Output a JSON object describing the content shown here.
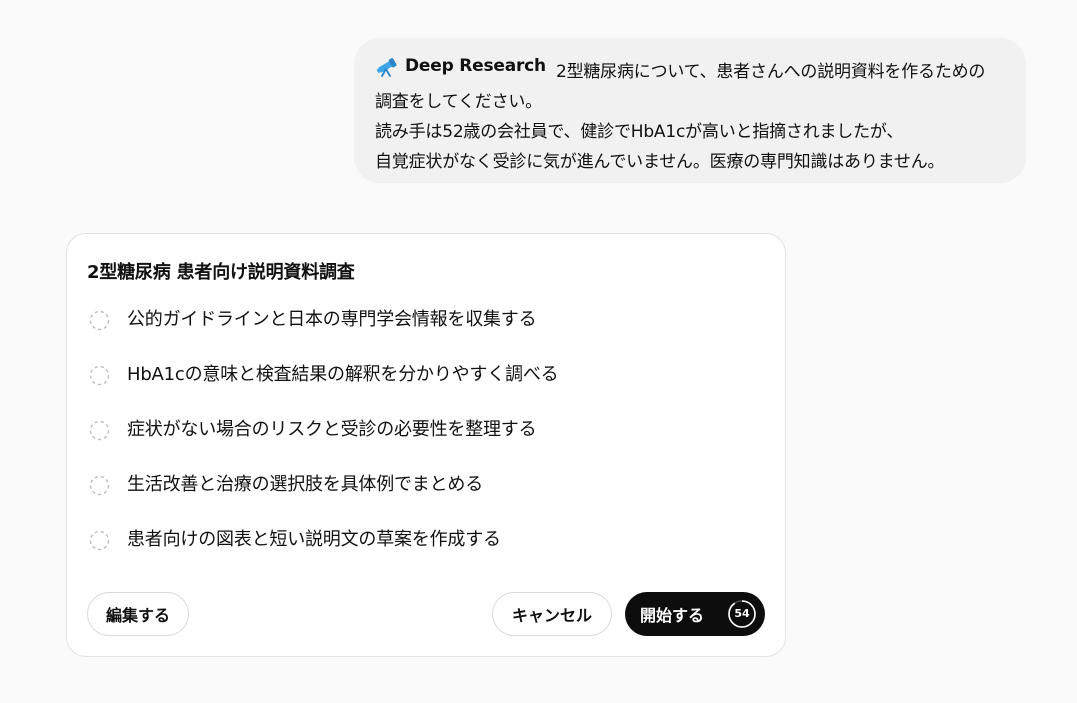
{
  "user_message": {
    "tag_label": "Deep Research",
    "tag_icon": "telescope-icon",
    "lines": [
      "2型糖尿病について、患者さんへの説明資料を作るための",
      "調査をしてください。",
      "読み手は52歳の会社員で、健診でHbA1cが高いと指摘されましたが、",
      "自覚症状がなく受診に気が進んでいません。医療の専門知識はありません。"
    ]
  },
  "plan": {
    "title": "2型糖尿病 患者向け説明資料調査",
    "steps": [
      {
        "label": "公的ガイドラインと日本の専門学会情報を収集する",
        "icon": "pending-circle-icon"
      },
      {
        "label": "HbA1cの意味と検査結果の解釈を分かりやすく調べる",
        "icon": "pending-circle-icon"
      },
      {
        "label": "症状がない場合のリスクと受診の必要性を整理する",
        "icon": "pending-circle-icon"
      },
      {
        "label": "生活改善と治療の選択肢を具体例でまとめる",
        "icon": "pending-circle-icon"
      },
      {
        "label": "患者向けの図表と短い説明文の草案を作成する",
        "icon": "pending-circle-icon"
      }
    ],
    "buttons": {
      "edit": "編集する",
      "cancel": "キャンセル",
      "start": "開始する"
    },
    "countdown": {
      "value": "54",
      "fraction_remaining": 0.9
    }
  },
  "colors": {
    "page_background": "#fafafa",
    "bubble_background": "#f1f1f1",
    "card_background": "#ffffff",
    "card_border": "#e3e3e3",
    "primary_button": "#0d0d0d",
    "telescope_accent": "#3ea6e8"
  }
}
